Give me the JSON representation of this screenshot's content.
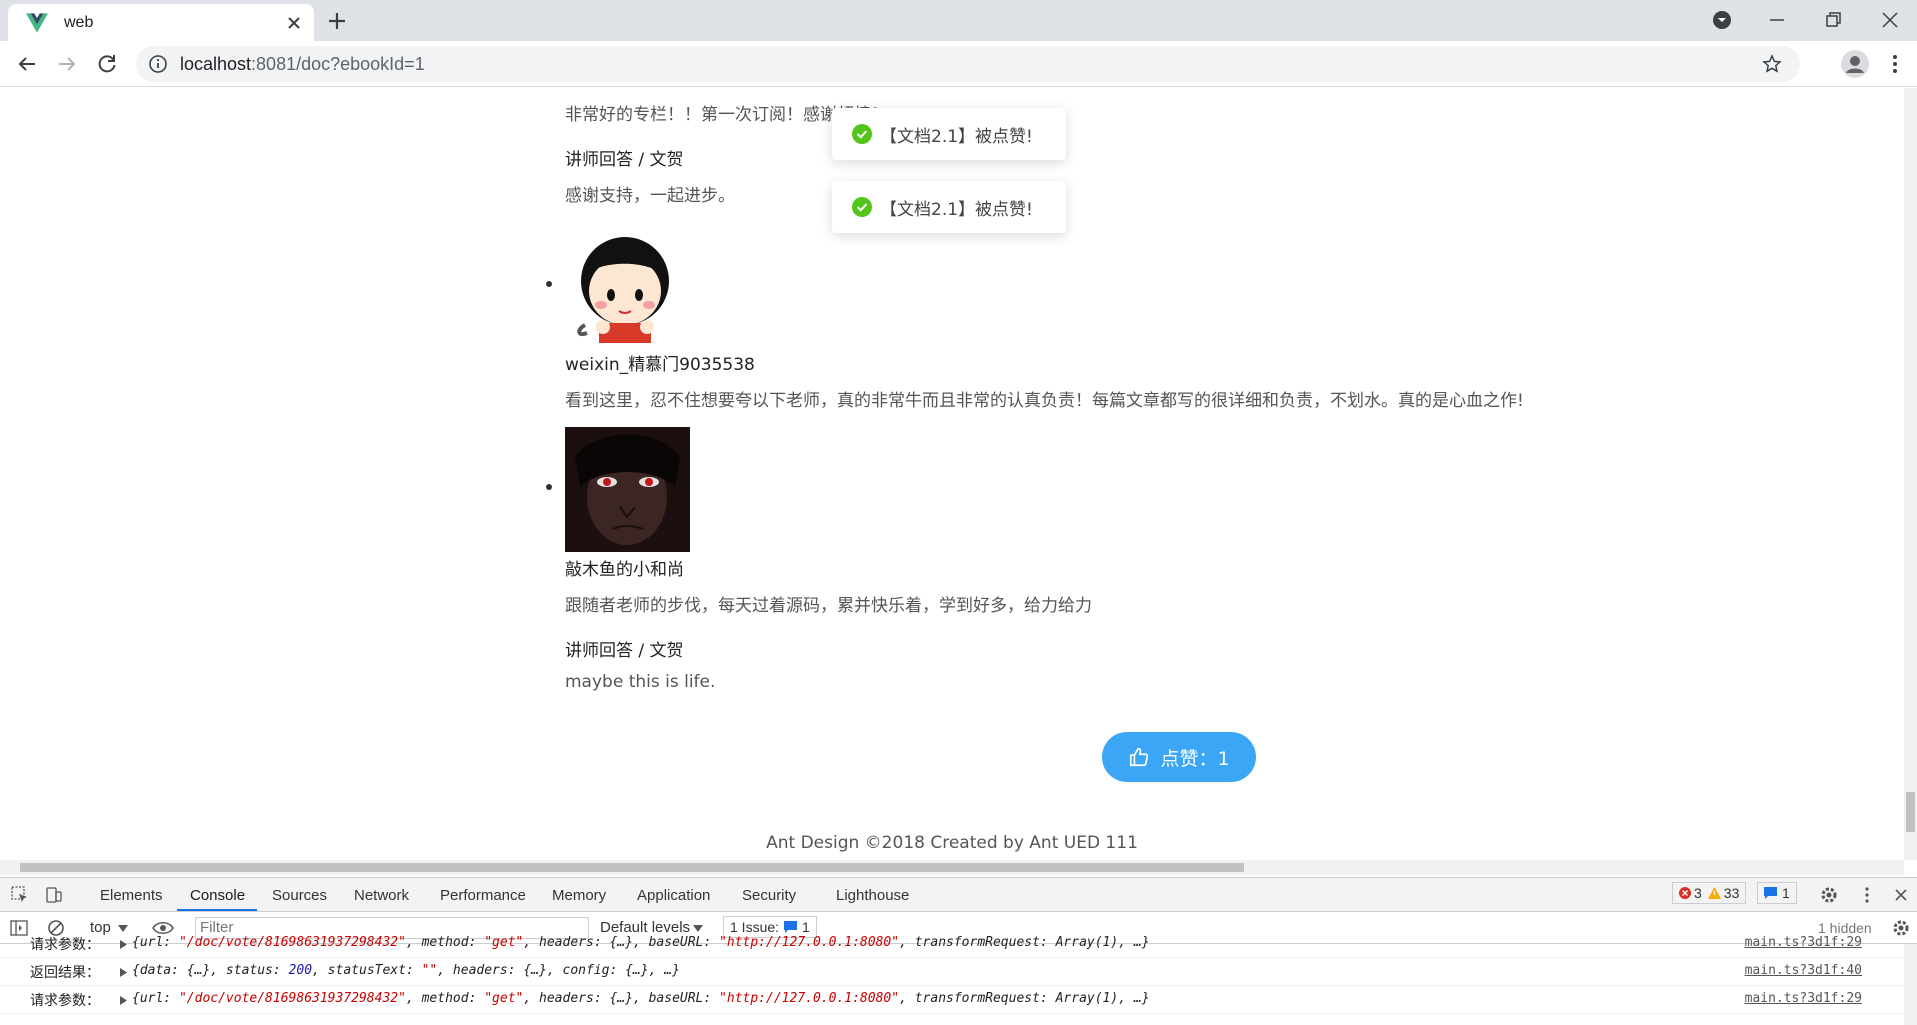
{
  "browser": {
    "tab_title": "web",
    "url_host": "localhost",
    "url_path": ":8081/doc?ebookId=1"
  },
  "page": {
    "comment1_text": "非常好的专栏！！第一次订阅！感谢超棒！",
    "reply1_heading": "讲师回答 / 文贺",
    "reply1_text": "感谢支持，一起进步。",
    "comment2_user": "weixin_精慕门9035538",
    "comment2_text": "看到这里，忍不住想要夸以下老师，真的非常牛而且非常的认真负责！每篇文章都写的很详细和负责，不划水。真的是心血之作!",
    "comment3_user": "敲木鱼的小和尚",
    "comment3_text": "跟随者老师的步伐，每天过着源码，累并快乐着，学到好多，给力给力",
    "reply3_heading": "讲师回答 / 文贺",
    "reply3_text": "maybe this is life.",
    "like_button": "点赞：1",
    "footer": "Ant Design ©2018 Created by Ant UED 111"
  },
  "toasts": [
    {
      "text": "【文档2.1】被点赞!"
    },
    {
      "text": "【文档2.1】被点赞!"
    }
  ],
  "devtools": {
    "tabs": [
      "Elements",
      "Console",
      "Sources",
      "Network",
      "Performance",
      "Memory",
      "Application",
      "Security",
      "Lighthouse"
    ],
    "active_tab": "Console",
    "error_count": "3",
    "warning_count": "33",
    "message_count": "1",
    "context": "top",
    "filter_placeholder": "Filter",
    "levels": "Default levels",
    "issues_label": "1 Issue:",
    "issues_count": "1",
    "hidden": "1 hidden",
    "rows": [
      {
        "label": "请求参数：",
        "value_prefix": "{url: ",
        "url_str": "\"/doc/vote/81698631937298432\"",
        "mid1": ", method: ",
        "method_str": "\"get\"",
        "mid2": ", headers: {…}, baseURL: ",
        "base_str": "\"http://127.0.0.1:8080\"",
        "tail": ", transformRequest: Array(1), …}",
        "source": "main.ts?3d1f:29"
      },
      {
        "label": "返回结果：",
        "value_prefix": "{data: {…}, status: ",
        "status_num": "200",
        "mid": ", statusText: ",
        "status_text": "\"\"",
        "tail": ", headers: {…}, config: {…}, …}",
        "source": "main.ts?3d1f:40"
      },
      {
        "label": "请求参数：",
        "value_prefix": "{url: ",
        "url_str": "\"/doc/vote/81698631937298432\"",
        "mid1": ", method: ",
        "method_str": "\"get\"",
        "mid2": ", headers: {…}, baseURL: ",
        "base_str": "\"http://127.0.0.1:8080\"",
        "tail": ", transformRequest: Array(1), …}",
        "source": "main.ts?3d1f:29"
      }
    ]
  }
}
